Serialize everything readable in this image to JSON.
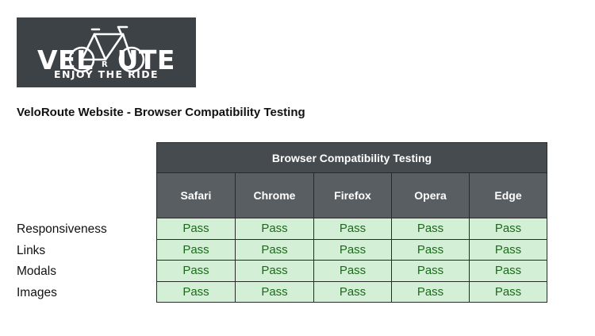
{
  "logo": {
    "word_left": "VEL",
    "word_right": "UTE",
    "small_r": "R",
    "tagline": "ENJOY THE RIDE"
  },
  "document": {
    "title": "VeloRoute Website - Browser Compatibility Testing"
  },
  "table": {
    "group_header": "Browser Compatibility Testing",
    "columns": [
      "Safari",
      "Chrome",
      "Firefox",
      "Opera",
      "Edge"
    ],
    "rows": [
      {
        "label": "Responsiveness",
        "cells": [
          "Pass",
          "Pass",
          "Pass",
          "Pass",
          "Pass"
        ]
      },
      {
        "label": "Links",
        "cells": [
          "Pass",
          "Pass",
          "Pass",
          "Pass",
          "Pass"
        ]
      },
      {
        "label": "Modals",
        "cells": [
          "Pass",
          "Pass",
          "Pass",
          "Pass",
          "Pass"
        ]
      },
      {
        "label": "Images",
        "cells": [
          "Pass",
          "Pass",
          "Pass",
          "Pass",
          "Pass"
        ]
      }
    ]
  },
  "colors": {
    "logo_bg": "#3c4246",
    "header_bg": "#595e62",
    "pass_bg": "#d3efd5",
    "pass_text": "#1c6a1c"
  },
  "icons": [
    "bicycle-icon"
  ]
}
